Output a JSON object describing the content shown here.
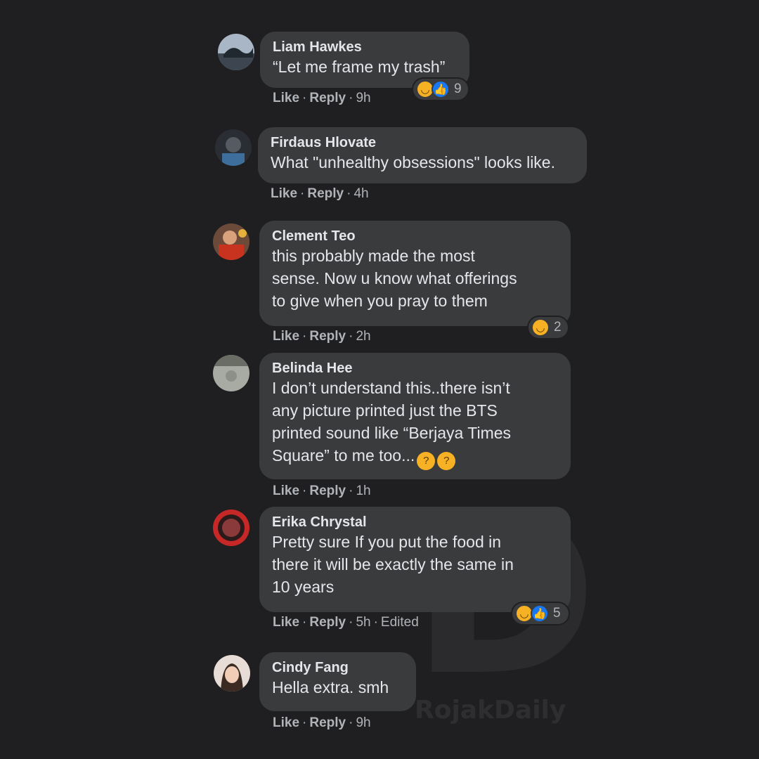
{
  "colors": {
    "background": "#1f1f21",
    "bubble": "#3a3b3c",
    "text": "#e4e6eb",
    "muted": "#b0b3b8",
    "haha_yellow": "#f7b125",
    "like_blue": "#1877f2"
  },
  "watermark": {
    "letter": "D",
    "brand": "RojakDaily"
  },
  "actions": {
    "like": "Like",
    "reply": "Reply",
    "dot": "·"
  },
  "comments": [
    {
      "name": "Liam Hawkes",
      "text": "“Let me frame my trash”",
      "time": "9h",
      "reactions": {
        "icons": [
          "haha-icon",
          "like-icon"
        ],
        "count": "9"
      }
    },
    {
      "name": "Firdaus Hlovate",
      "text": "What \"unhealthy obsessions\" looks like.",
      "time": "4h"
    },
    {
      "name": "Clement Teo",
      "text": "this probably made the most\nsense. Now u know what offerings\nto give when you pray to them",
      "time": "2h",
      "reactions": {
        "icons": [
          "haha-icon"
        ],
        "count": "2"
      }
    },
    {
      "name": "Belinda Hee",
      "text": "I don’t understand this..there isn’t\nany picture printed just the BTS\nprinted sound like “Berjaya Times\nSquare” to me too...",
      "inline_emojis": [
        "thinking-face-icon",
        "thinking-face-icon"
      ],
      "time": "1h"
    },
    {
      "name": "Erika Chrystal",
      "text": "Pretty sure If you put the food in\nthere it will be exactly the same in\n10 years",
      "time": "5h",
      "edited": "Edited",
      "reactions": {
        "icons": [
          "haha-icon",
          "like-icon"
        ],
        "count": "5"
      }
    },
    {
      "name": "Cindy Fang",
      "text": "Hella extra. smh",
      "time": "9h"
    }
  ]
}
